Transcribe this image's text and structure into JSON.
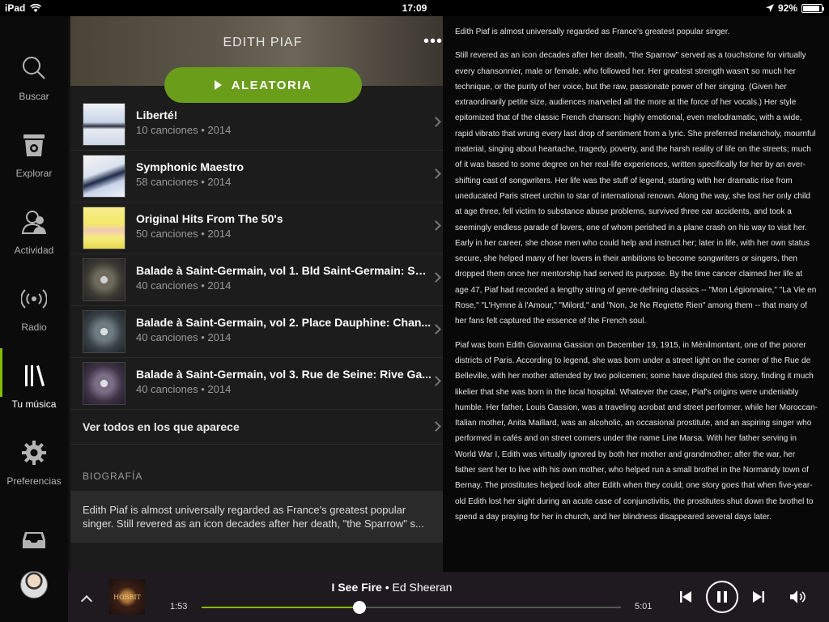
{
  "status_bar": {
    "device": "iPad",
    "time": "17:09",
    "battery": "92%",
    "battery_level": 0.92
  },
  "sidebar": {
    "items": [
      {
        "label": "Buscar",
        "icon": "search-icon"
      },
      {
        "label": "Explorar",
        "icon": "browse-icon"
      },
      {
        "label": "Actividad",
        "icon": "activity-icon"
      },
      {
        "label": "Radio",
        "icon": "radio-icon"
      },
      {
        "label": "Tu música",
        "icon": "library-icon",
        "active": true
      },
      {
        "label": "Preferencias",
        "icon": "gear-icon"
      }
    ],
    "inbox_icon": "inbox-icon"
  },
  "artist": {
    "name": "EDITH PIAF",
    "shuffle_label": "ALEATORIA"
  },
  "albums": [
    {
      "title": "Liberté!",
      "meta": "10 canciones • 2014"
    },
    {
      "title": "Symphonic Maestro",
      "meta": "58 canciones • 2014"
    },
    {
      "title": "Original Hits From The 50's",
      "meta": "50 canciones • 2014"
    },
    {
      "title": "Balade à Saint-Germain, vol 1. Bld Saint-Germain: Sm...",
      "meta": "40 canciones • 2014"
    },
    {
      "title": "Balade à Saint-Germain, vol 2. Place Dauphine: Chan...",
      "meta": "40 canciones • 2014"
    },
    {
      "title": "Balade à Saint-Germain, vol 3. Rue de Seine: Rive Ga...",
      "meta": "40 canciones • 2014"
    }
  ],
  "see_all_label": "Ver todos en los que aparece",
  "biography": {
    "heading": "BIOGRAFÍA",
    "preview": "Edith Piaf is almost universally regarded as France's greatest popular singer. Still revered as an icon decades after her death, \"the Sparrow\" s...",
    "paragraphs": [
      "Edith Piaf is almost universally regarded as France's greatest popular singer.",
      "Still revered as an icon decades after her death, \"the Sparrow\" served as a touchstone for virtually every chansonnier, male or female, who followed her. Her greatest strength wasn't so much her technique, or the purity of her voice, but the raw, passionate power of her singing. (Given her extraordinarily petite size, audiences marveled all the more at the force of her vocals.) Her style epitomized that of the classic French chanson: highly emotional, even melodramatic, with a wide, rapid vibrato that wrung every last drop of sentiment from a lyric. She preferred melancholy, mournful material, singing about heartache, tragedy, poverty, and the harsh reality of life on the streets; much of it was based to some degree on her real-life experiences, written specifically for her by an ever-shifting cast of songwriters. Her life was the stuff of legend, starting with her dramatic rise from uneducated Paris street urchin to star of international renown. Along the way, she lost her only child at age three, fell victim to substance abuse problems, survived three car accidents, and took a seemingly endless parade of lovers, one of whom perished in a plane crash on his way to visit her. Early in her career, she chose men who could help and instruct her; later in life, with her own status secure, she helped many of her lovers in their ambitions to become songwriters or singers, then dropped them once her mentorship had served its purpose. By the time cancer claimed her life at age 47, Piaf had recorded a lengthy string of genre-defining classics -- \"Mon Légionnaire,\" \"La Vie en Rose,\" \"L'Hymne à l'Amour,\" \"Milord,\" and \"Non, Je Ne Regrette Rien\" among them -- that many of her fans felt captured the essence of the French soul.",
      "Piaf was born Edith Giovanna Gassion on December 19, 1915, in Ménilmontant, one of the poorer districts of Paris. According to legend, she was born under a street light on the corner of the Rue de Belleville, with her mother attended by two policemen; some have disputed this story, finding it much likelier that she was born in the local hospital. Whatever the case, Piaf's origins were undeniably humble. Her father, Louis Gassion, was a traveling acrobat and street performer, while her Moroccan-Italian mother, Anita Maillard, was an alcoholic, an occasional prostitute, and an aspiring singer who performed in cafés and on street corners under the name Line Marsa. With her father serving in World War I, Edith was virtually ignored by both her mother and grandmother; after the war, her father sent her to live with his own mother, who helped run a small brothel in the Normandy town of Bernay. The prostitutes helped look after Edith when they could; one story goes that when five-year-old Edith lost her sight during an acute case of conjunctivitis, the prostitutes shut down the brothel to spend a day praying for her in church, and her blindness disappeared several days later."
    ]
  },
  "player": {
    "track": "I See Fire",
    "separator": " • ",
    "artist": "Ed Sheeran",
    "cover_text": "HOBBIT",
    "elapsed": "1:53",
    "total": "5:01",
    "progress": 0.376
  },
  "colors": {
    "accent": "#84bd00",
    "shuffle": "#6a9e1a"
  }
}
